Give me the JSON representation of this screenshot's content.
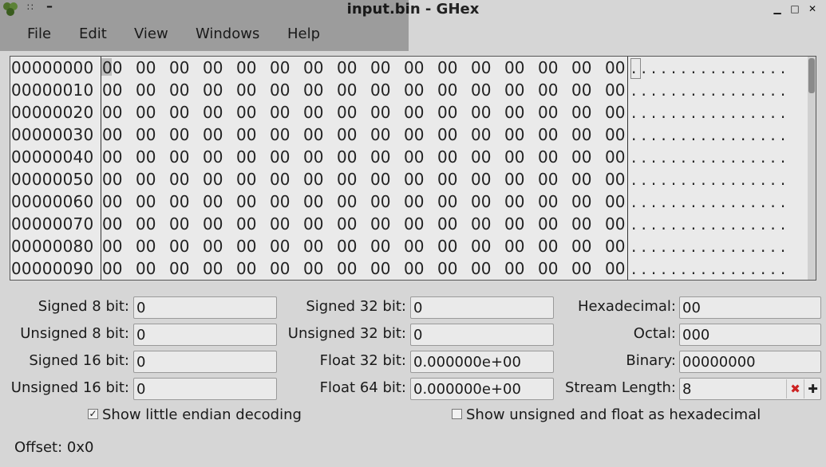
{
  "window": {
    "title": "input.bin - GHex",
    "controls": {
      "minimize": "▁",
      "maximize": "□",
      "close": "✕"
    }
  },
  "menu": [
    "File",
    "Edit",
    "View",
    "Windows",
    "Help"
  ],
  "hex": {
    "rows": [
      {
        "offset": "00000000",
        "bytes": [
          "00",
          "00",
          "00",
          "00",
          "00",
          "00",
          "00",
          "00",
          "00",
          "00",
          "00",
          "00",
          "00",
          "00",
          "00",
          "00"
        ],
        "ascii": "................"
      },
      {
        "offset": "00000010",
        "bytes": [
          "00",
          "00",
          "00",
          "00",
          "00",
          "00",
          "00",
          "00",
          "00",
          "00",
          "00",
          "00",
          "00",
          "00",
          "00",
          "00"
        ],
        "ascii": "................"
      },
      {
        "offset": "00000020",
        "bytes": [
          "00",
          "00",
          "00",
          "00",
          "00",
          "00",
          "00",
          "00",
          "00",
          "00",
          "00",
          "00",
          "00",
          "00",
          "00",
          "00"
        ],
        "ascii": "................"
      },
      {
        "offset": "00000030",
        "bytes": [
          "00",
          "00",
          "00",
          "00",
          "00",
          "00",
          "00",
          "00",
          "00",
          "00",
          "00",
          "00",
          "00",
          "00",
          "00",
          "00"
        ],
        "ascii": "................"
      },
      {
        "offset": "00000040",
        "bytes": [
          "00",
          "00",
          "00",
          "00",
          "00",
          "00",
          "00",
          "00",
          "00",
          "00",
          "00",
          "00",
          "00",
          "00",
          "00",
          "00"
        ],
        "ascii": "................"
      },
      {
        "offset": "00000050",
        "bytes": [
          "00",
          "00",
          "00",
          "00",
          "00",
          "00",
          "00",
          "00",
          "00",
          "00",
          "00",
          "00",
          "00",
          "00",
          "00",
          "00"
        ],
        "ascii": "................"
      },
      {
        "offset": "00000060",
        "bytes": [
          "00",
          "00",
          "00",
          "00",
          "00",
          "00",
          "00",
          "00",
          "00",
          "00",
          "00",
          "00",
          "00",
          "00",
          "00",
          "00"
        ],
        "ascii": "................"
      },
      {
        "offset": "00000070",
        "bytes": [
          "00",
          "00",
          "00",
          "00",
          "00",
          "00",
          "00",
          "00",
          "00",
          "00",
          "00",
          "00",
          "00",
          "00",
          "00",
          "00"
        ],
        "ascii": "................"
      },
      {
        "offset": "00000080",
        "bytes": [
          "00",
          "00",
          "00",
          "00",
          "00",
          "00",
          "00",
          "00",
          "00",
          "00",
          "00",
          "00",
          "00",
          "00",
          "00",
          "00"
        ],
        "ascii": "................"
      },
      {
        "offset": "00000090",
        "bytes": [
          "00",
          "00",
          "00",
          "00",
          "00",
          "00",
          "00",
          "00",
          "00",
          "00",
          "00",
          "00",
          "00",
          "00",
          "00",
          "00"
        ],
        "ascii": "................"
      }
    ]
  },
  "converter": {
    "signed8": {
      "label": "Signed 8 bit:",
      "value": "0"
    },
    "unsigned8": {
      "label": "Unsigned 8 bit:",
      "value": "0"
    },
    "signed16": {
      "label": "Signed 16 bit:",
      "value": "0"
    },
    "unsigned16": {
      "label": "Unsigned 16 bit:",
      "value": "0"
    },
    "signed32": {
      "label": "Signed 32 bit:",
      "value": "0"
    },
    "unsigned32": {
      "label": "Unsigned 32 bit:",
      "value": "0"
    },
    "float32": {
      "label": "Float 32 bit:",
      "value": "0.000000e+00"
    },
    "float64": {
      "label": "Float 64 bit:",
      "value": "0.000000e+00"
    },
    "hex": {
      "label": "Hexadecimal:",
      "value": "00"
    },
    "octal": {
      "label": "Octal:",
      "value": "000"
    },
    "binary": {
      "label": "Binary:",
      "value": "00000000"
    },
    "stream": {
      "label": "Stream Length:",
      "value": "8",
      "minus": "✖",
      "plus": "✚"
    }
  },
  "options": {
    "little_endian": {
      "label": "Show little endian decoding",
      "checked": true,
      "mark": "✓"
    },
    "unsigned_hex": {
      "label": "Show unsigned and float as hexadecimal",
      "checked": false
    }
  },
  "status": {
    "offset": "Offset: 0x0"
  },
  "colors": {
    "accent_red": "#cc2222",
    "logo_green": "#6a9a3a"
  }
}
